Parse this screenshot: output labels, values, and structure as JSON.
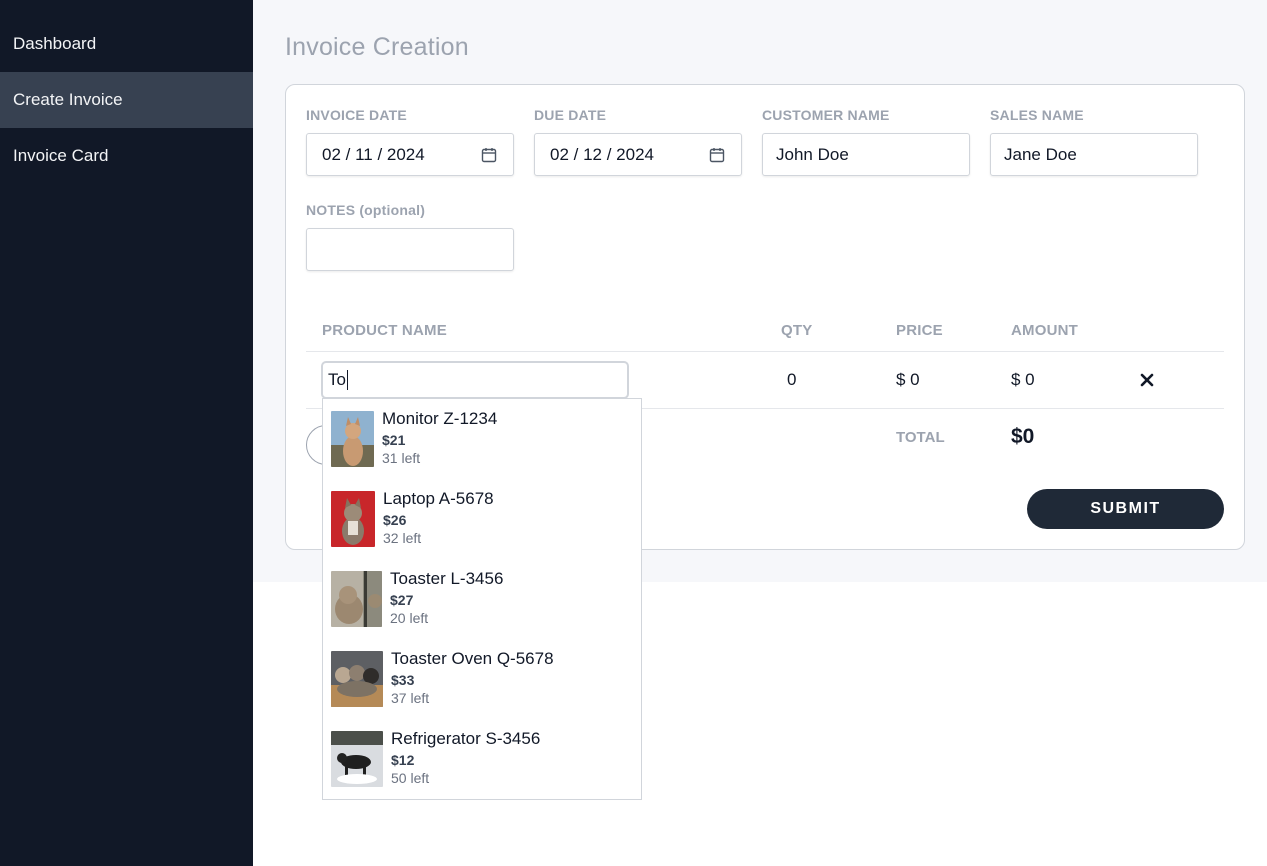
{
  "sidebar": {
    "items": [
      {
        "label": "Dashboard"
      },
      {
        "label": "Create Invoice"
      },
      {
        "label": "Invoice Card"
      }
    ]
  },
  "page": {
    "title": "Invoice Creation"
  },
  "form": {
    "invoice_date": {
      "label": "INVOICE DATE",
      "value": "02 / 11 / 2024"
    },
    "due_date": {
      "label": "DUE DATE",
      "value": "02 / 12 / 2024"
    },
    "customer_name": {
      "label": "CUSTOMER NAME",
      "value": "John Doe"
    },
    "sales_name": {
      "label": "SALES NAME",
      "value": "Jane Doe"
    },
    "notes": {
      "label": "NOTES (optional)",
      "value": ""
    }
  },
  "table": {
    "headers": {
      "product": "PRODUCT NAME",
      "qty": "QTY",
      "price": "PRICE",
      "amount": "AMOUNT"
    },
    "row": {
      "product_input": "To",
      "qty": "0",
      "price": "$ 0",
      "amount": "$ 0"
    },
    "total_label": "TOTAL",
    "total_value": "$0"
  },
  "submit_label": "SUBMIT",
  "dropdown": {
    "options": [
      {
        "name": "Monitor Z-1234",
        "price": "$21",
        "stock": "31 left"
      },
      {
        "name": "Laptop A-5678",
        "price": "$26",
        "stock": "32 left"
      },
      {
        "name": "Toaster L-3456",
        "price": "$27",
        "stock": "20 left"
      },
      {
        "name": "Toaster Oven Q-5678",
        "price": "$33",
        "stock": "37 left"
      },
      {
        "name": "Refrigerator S-3456",
        "price": "$12",
        "stock": "50 left"
      }
    ]
  },
  "colors": {
    "sidebar_bg": "#111827",
    "sidebar_active": "#374151",
    "submit_bg": "#1f2937",
    "label_gray": "#9ca3af"
  },
  "icons": {
    "date": "calendar-icon",
    "remove": "close-icon",
    "thumb": "product-photo"
  }
}
